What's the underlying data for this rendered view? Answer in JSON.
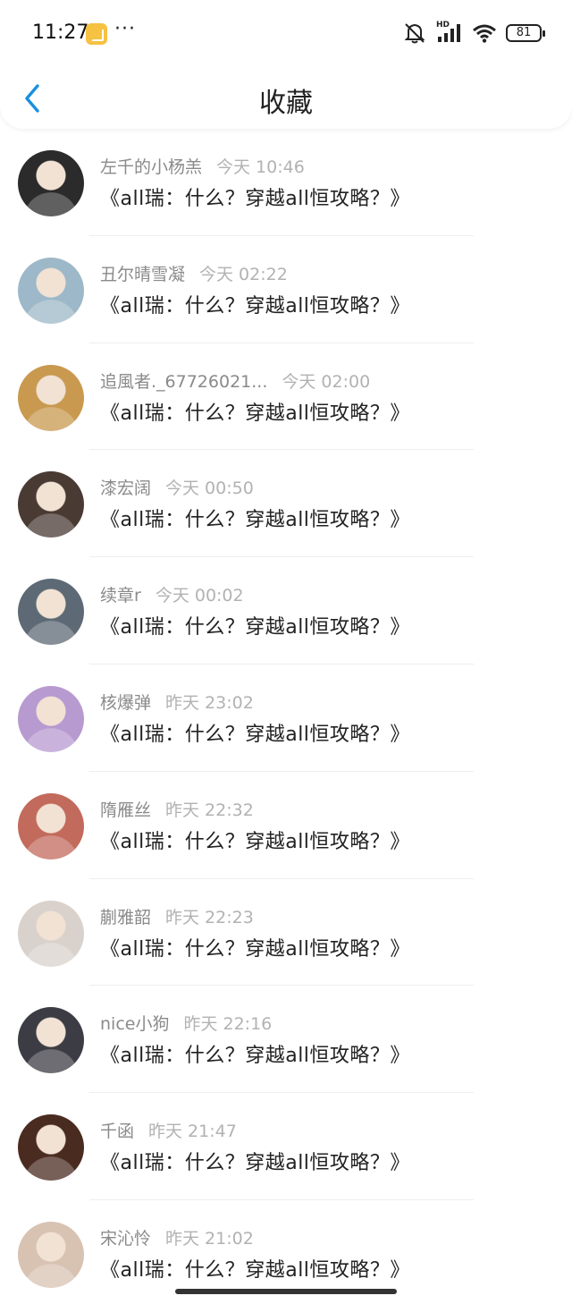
{
  "status_bar": {
    "time": "11:27",
    "more": "···",
    "signal_label": "HD",
    "battery": "81"
  },
  "header": {
    "title": "收藏",
    "back_icon": "chevron-left-icon",
    "accent_color": "#1a8fe0"
  },
  "items": [
    {
      "name": "左千的小杨羔",
      "time": "今天 10:46",
      "message": "《all瑞：什么？穿越all恒攻略？》",
      "avatar_color": "#2b2b2b"
    },
    {
      "name": "丑尔晴雪凝",
      "time": "今天 02:22",
      "message": "《all瑞：什么？穿越all恒攻略？》",
      "avatar_color": "#9db8c8"
    },
    {
      "name": "追風者._67726021...",
      "time": "今天 02:00",
      "message": "《all瑞：什么？穿越all恒攻略？》",
      "avatar_color": "#c8994f"
    },
    {
      "name": "漆宏阔",
      "time": "今天 00:50",
      "message": "《all瑞：什么？穿越all恒攻略？》",
      "avatar_color": "#4a3a34"
    },
    {
      "name": "续章r",
      "time": "今天 00:02",
      "message": "《all瑞：什么？穿越all恒攻略？》",
      "avatar_color": "#5d6a75"
    },
    {
      "name": "核爆弹",
      "time": "昨天 23:02",
      "message": "《all瑞：什么？穿越all恒攻略？》",
      "avatar_color": "#b79ad0"
    },
    {
      "name": "隋雁丝",
      "time": "昨天 22:32",
      "message": "《all瑞：什么？穿越all恒攻略？》",
      "avatar_color": "#c26a5c"
    },
    {
      "name": "蒯雅韶",
      "time": "昨天 22:23",
      "message": "《all瑞：什么？穿越all恒攻略？》",
      "avatar_color": "#d9d2cc"
    },
    {
      "name": "nice小狗",
      "time": "昨天 22:16",
      "message": "《all瑞：什么？穿越all恒攻略？》",
      "avatar_color": "#3c3c44"
    },
    {
      "name": "千函",
      "time": "昨天 21:47",
      "message": "《all瑞：什么？穿越all恒攻略？》",
      "avatar_color": "#4a2b20"
    },
    {
      "name": "宋沁怜",
      "time": "昨天 21:02",
      "message": "《all瑞：什么？穿越all恒攻略？》",
      "avatar_color": "#d8c2b2"
    }
  ]
}
